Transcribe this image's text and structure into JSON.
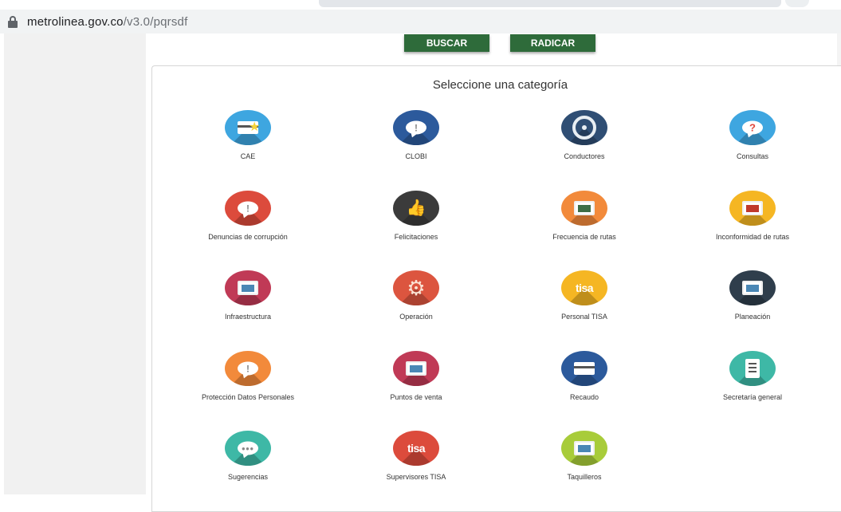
{
  "browser": {
    "url_host": "metrolinea.gov.co",
    "url_path": "/v3.0/pqrsdf"
  },
  "buttons": {
    "buscar": "BUSCAR",
    "radicar": "RADICAR"
  },
  "panel": {
    "title": "Seleccione una categoría"
  },
  "categories": [
    {
      "label": "CAE",
      "color": "#3ea6e0",
      "icon": "credit-card-star-icon"
    },
    {
      "label": "CLOBI",
      "color": "#2c5a9c",
      "icon": "speech-bubble-icon"
    },
    {
      "label": "Conductores",
      "color": "#2f4e74",
      "icon": "steering-wheel-icon"
    },
    {
      "label": "Consultas",
      "color": "#3ea6e0",
      "icon": "question-bubble-icon",
      "mark": "?"
    },
    {
      "label": "Denuncias de corrupción",
      "color": "#dc4b3c",
      "icon": "alert-bubble-icon"
    },
    {
      "label": "Felicitaciones",
      "color": "#3b3b3b",
      "icon": "thumbs-up-icon",
      "mark": "👍"
    },
    {
      "label": "Frecuencia de rutas",
      "color": "#f28a3b",
      "icon": "bus-clock-icon"
    },
    {
      "label": "Inconformidad de rutas",
      "color": "#f5b623",
      "icon": "bus-alert-icon"
    },
    {
      "label": "Infraestructura",
      "color": "#c03a56",
      "icon": "bus-stop-icon"
    },
    {
      "label": "Operación",
      "color": "#dc553f",
      "icon": "gears-icon",
      "mark": "⚙"
    },
    {
      "label": "Personal TISA",
      "color": "#f5b623",
      "icon": "tisa-logo-icon",
      "mark": "tisa"
    },
    {
      "label": "Planeación",
      "color": "#2f3e4c",
      "icon": "route-map-icon"
    },
    {
      "label": "Protección Datos Personales",
      "color": "#f28a3b",
      "icon": "privacy-bubble-icon"
    },
    {
      "label": "Puntos de venta",
      "color": "#c03a56",
      "icon": "sales-screen-icon"
    },
    {
      "label": "Recaudo",
      "color": "#2c5a9c",
      "icon": "fare-card-icon"
    },
    {
      "label": "Secretaría general",
      "color": "#3eb8a6",
      "icon": "clipboard-icon"
    },
    {
      "label": "Sugerencias",
      "color": "#3eb8a6",
      "icon": "dots-bubble-icon",
      "mark": "•••"
    },
    {
      "label": "Supervisores TISA",
      "color": "#dc4b3c",
      "icon": "tisa-search-icon",
      "mark": "tisa"
    },
    {
      "label": "Taquilleros",
      "color": "#a8cc3a",
      "icon": "ticket-window-icon"
    }
  ]
}
